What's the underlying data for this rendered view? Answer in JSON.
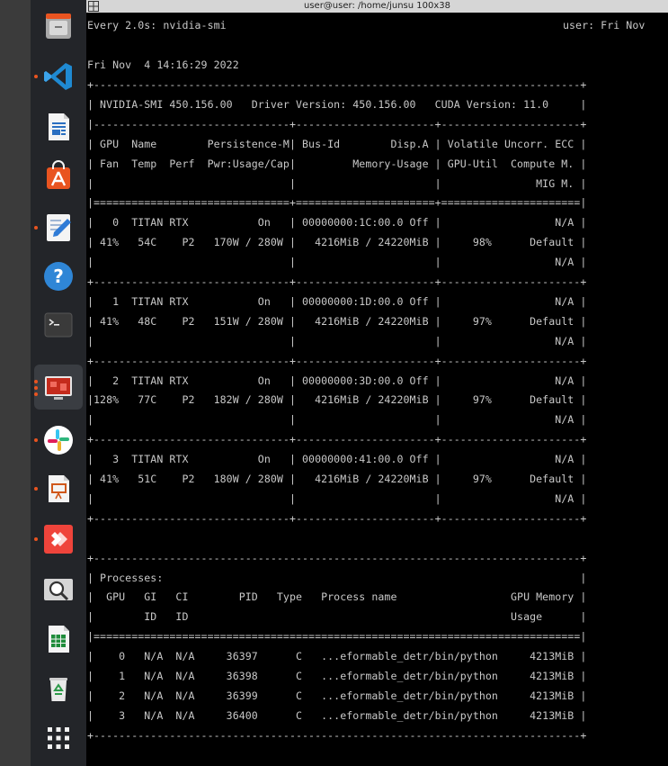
{
  "window": {
    "title": "user@user: /home/junsu 100x38"
  },
  "dock": {
    "items": [
      {
        "name": "files",
        "icon": "file-cabinet-icon",
        "indicator": "none"
      },
      {
        "name": "vscode",
        "icon": "vscode-icon",
        "indicator": "dot"
      },
      {
        "name": "writer",
        "icon": "document-icon",
        "indicator": "none"
      },
      {
        "name": "software",
        "icon": "shopping-bag-icon",
        "indicator": "none"
      },
      {
        "name": "text-editor",
        "icon": "text-editor-icon",
        "indicator": "dot"
      },
      {
        "name": "help",
        "icon": "help-icon",
        "indicator": "none"
      },
      {
        "name": "terminal",
        "icon": "terminal-icon",
        "indicator": "none"
      },
      {
        "name": "remote-desktop",
        "icon": "remote-desktop-icon",
        "indicator": "three-dots"
      },
      {
        "name": "slack",
        "icon": "slack-icon",
        "indicator": "dot"
      },
      {
        "name": "impress",
        "icon": "presentation-icon",
        "indicator": "dot"
      },
      {
        "name": "anydesk",
        "icon": "anydesk-icon",
        "indicator": "dot"
      },
      {
        "name": "search-viewer",
        "icon": "magnifier-icon",
        "indicator": "none"
      },
      {
        "name": "calc",
        "icon": "spreadsheet-icon",
        "indicator": "none"
      },
      {
        "name": "trash",
        "icon": "trash-icon",
        "indicator": "none"
      },
      {
        "name": "show-apps",
        "icon": "app-grid-icon",
        "indicator": "none"
      }
    ],
    "accent": "#e95420"
  },
  "terminal": {
    "header_left": "Every 2.0s: nvidia-smi",
    "header_right": "user: Fri Nov",
    "timestamp": "Fri Nov  4 14:16:29 2022",
    "lines": [
      "+-----------------------------------------------------------------------------+",
      "| NVIDIA-SMI 450.156.00   Driver Version: 450.156.00   CUDA Version: 11.0     |",
      "|-------------------------------+----------------------+----------------------+",
      "| GPU  Name        Persistence-M| Bus-Id        Disp.A | Volatile Uncorr. ECC |",
      "| Fan  Temp  Perf  Pwr:Usage/Cap|         Memory-Usage | GPU-Util  Compute M. |",
      "|                               |                      |               MIG M. |",
      "|===============================+======================+======================|",
      "|   0  TITAN RTX           On   | 00000000:1C:00.0 Off |                  N/A |",
      "| 41%   54C    P2   170W / 280W |   4216MiB / 24220MiB |     98%      Default |",
      "|                               |                      |                  N/A |",
      "+-------------------------------+----------------------+----------------------+",
      "|   1  TITAN RTX           On   | 00000000:1D:00.0 Off |                  N/A |",
      "| 41%   48C    P2   151W / 280W |   4216MiB / 24220MiB |     97%      Default |",
      "|                               |                      |                  N/A |",
      "+-------------------------------+----------------------+----------------------+",
      "|   2  TITAN RTX           On   | 00000000:3D:00.0 Off |                  N/A |",
      "|128%   77C    P2   182W / 280W |   4216MiB / 24220MiB |     97%      Default |",
      "|                               |                      |                  N/A |",
      "+-------------------------------+----------------------+----------------------+",
      "|   3  TITAN RTX           On   | 00000000:41:00.0 Off |                  N/A |",
      "| 41%   51C    P2   180W / 280W |   4216MiB / 24220MiB |     97%      Default |",
      "|                               |                      |                  N/A |",
      "+-------------------------------+----------------------+----------------------+",
      "",
      "+-----------------------------------------------------------------------------+",
      "| Processes:                                                                  |",
      "|  GPU   GI   CI        PID   Type   Process name                  GPU Memory |",
      "|        ID   ID                                                   Usage      |",
      "|=============================================================================|",
      "|    0   N/A  N/A     36397      C   ...eformable_detr/bin/python     4213MiB |",
      "|    1   N/A  N/A     36398      C   ...eformable_detr/bin/python     4213MiB |",
      "|    2   N/A  N/A     36399      C   ...eformable_detr/bin/python     4213MiB |",
      "|    3   N/A  N/A     36400      C   ...eformable_detr/bin/python     4213MiB |",
      "+-----------------------------------------------------------------------------+"
    ]
  }
}
